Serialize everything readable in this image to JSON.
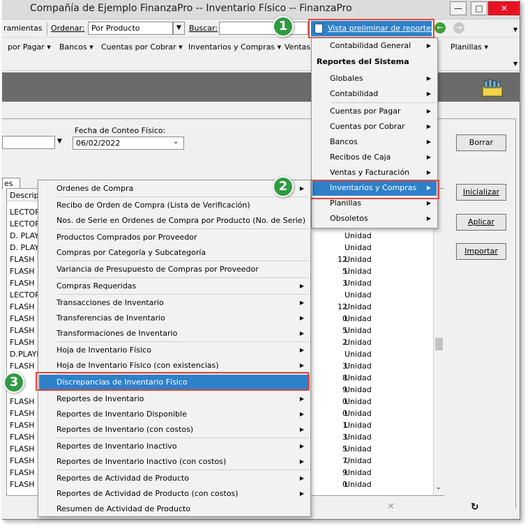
{
  "window": {
    "title": "Compañía de Ejemplo FinanzaPro -- Inventario Físico -- FinanzaPro"
  },
  "toolbar": {
    "herramientas_label": "ramientas",
    "ordenar_label": "Ordenar:",
    "ordenar_value": "Por Producto",
    "buscar_label": "Buscar:",
    "preview_label": "Vista preliminar de reportes"
  },
  "menubar": {
    "items": [
      "por Pagar",
      "Bancos",
      "Cuentas por Cobrar",
      "Inventarios y Compras",
      "Ventas"
    ],
    "planillas": "Planillas"
  },
  "form": {
    "fecha_label": "Fecha de Conteo Físico:",
    "fecha_value": "06/02/2022",
    "tab_label": "es",
    "col_header": "Descripc"
  },
  "buttons": {
    "borrar": "Borrar",
    "inicializar": "Inicializar",
    "aplicar": "Aplicar",
    "importar": "Importar"
  },
  "grid_rows": [
    {
      "desc": "LECTOR",
      "qty": "",
      "unit": ""
    },
    {
      "desc": "LECTOR",
      "qty": "",
      "unit": ""
    },
    {
      "desc": "D. PLAY",
      "qty": "",
      "unit": "Unidad"
    },
    {
      "desc": "D. PLAY",
      "qty": "",
      "unit": "Unidad"
    },
    {
      "desc": "FLASH D",
      "qty": "12",
      "unit": "Unidad"
    },
    {
      "desc": "FLASH D",
      "qty": "5",
      "unit": "Unidad"
    },
    {
      "desc": "FLASH D",
      "qty": "3",
      "unit": "Unidad"
    },
    {
      "desc": "LECTOR",
      "qty": "",
      "unit": "Unidad"
    },
    {
      "desc": "FLASH D",
      "qty": "12",
      "unit": "Unidad"
    },
    {
      "desc": "FLASH D",
      "qty": "0",
      "unit": "Unidad"
    },
    {
      "desc": "FLASH D",
      "qty": "5",
      "unit": "Unidad"
    },
    {
      "desc": "FLASH D",
      "qty": "2",
      "unit": "Unidad"
    },
    {
      "desc": "D.PLAYE",
      "qty": "",
      "unit": "Unidad"
    },
    {
      "desc": "FLASH D",
      "qty": "3",
      "unit": "Unidad"
    },
    {
      "desc": "",
      "qty": "8",
      "unit": "Unidad"
    },
    {
      "desc": "",
      "qty": "9",
      "unit": "Unidad"
    },
    {
      "desc": "FLASH D",
      "qty": "0",
      "unit": "Unidad"
    },
    {
      "desc": "FLASH D",
      "qty": "0",
      "unit": "Unidad"
    },
    {
      "desc": "FLASH D",
      "qty": "1",
      "unit": "Unidad"
    },
    {
      "desc": "FLASH D",
      "qty": "3",
      "unit": "Unidad"
    },
    {
      "desc": "FLASH D",
      "qty": "5",
      "unit": "Unidad"
    },
    {
      "desc": "FLASH D",
      "qty": "7",
      "unit": "Unidad"
    },
    {
      "desc": "FLASH D",
      "qty": "9",
      "unit": "Unidad"
    },
    {
      "desc": "FLASH D",
      "qty": "0",
      "unit": "Unidad"
    }
  ],
  "reports_menu": {
    "contabilidad_general": "Contabilidad General",
    "header": "Reportes del Sistema",
    "items": [
      "Globales",
      "Contabilidad",
      "Cuentas por Pagar",
      "Cuentas por Cobrar",
      "Bancos",
      "Recibos de Caja",
      "Ventas y Facturación",
      "Inventarios y Compras",
      "Planillas",
      "Obsoletos"
    ]
  },
  "inventory_menu": {
    "items": [
      "Ordenes de Compra",
      "Recibo de Orden de Compra (Lista de Verificación)",
      "Nos. de Serie en Ordenes de Compra por Producto (No. de Serie)",
      "Productos Comprados por Proveedor",
      "Compras por Categoría y Subcategoría",
      "Variancia de Presupuesto de Compras por Proveedor",
      "Compras Requeridas",
      "Transacciones de Inventario",
      "Transferencias de Inventario",
      "Transformaciones de Inventario",
      "Hoja de Inventario Físico",
      "Hoja de Inventario Físico (con existencias)",
      "Discrepancias de Inventario Físico",
      "Reportes de Inventario",
      "Reportes de Inventario Disponible",
      "Reportes de Inventario (con costos)",
      "Reportes de Inventario Inactivo",
      "Reportes de Inventario Inactivo (con costos)",
      "Reportes de Actividad de Producto",
      "Reportes de Actividad de Producto (con costos)",
      "Resumen de Actividad de Producto"
    ]
  },
  "badges": [
    "1",
    "2",
    "3"
  ],
  "colors": {
    "highlight": "#2e80c9",
    "callout_red": "#e0463b",
    "badge_green": "#2f9a43"
  }
}
